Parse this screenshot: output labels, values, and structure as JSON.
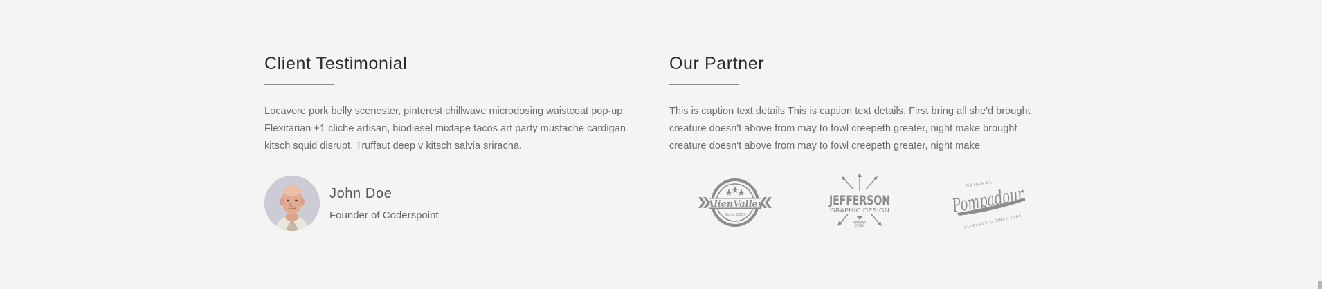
{
  "testimonial": {
    "title": "Client Testimonial",
    "quote": "Locavore pork belly scenester, pinterest chillwave microdosing waistcoat pop-up. Flexitarian +1 cliche artisan, biodiesel mixtape tacos art party mustache cardigan kitsch squid disrupt. Truffaut deep v kitsch salvia sriracha.",
    "author_name": "John Doe",
    "author_role": "Founder of Coderspoint"
  },
  "partner": {
    "title": "Our Partner",
    "caption": "This is caption text details This is caption text details. First bring all she'd brought creature doesn't above from may to fowl creepeth greater, night make brought creature doesn't above from may to fowl creepeth greater, night make",
    "logos": [
      {
        "name": "AlienValley",
        "sub": "Since 2009"
      },
      {
        "name": "JEFFERSON",
        "sub": "GRAPHIC DESIGN",
        "year": "2016"
      },
      {
        "name": "Pompadour",
        "top": "ORIGINAL",
        "bottom": "ELEGANCE & SINCE 1986"
      }
    ]
  },
  "colors": {
    "background": "#f4f4f4",
    "heading": "#2b2b2b",
    "body_text": "#6b6b6b",
    "logo_gray": "#8c8c8c"
  }
}
